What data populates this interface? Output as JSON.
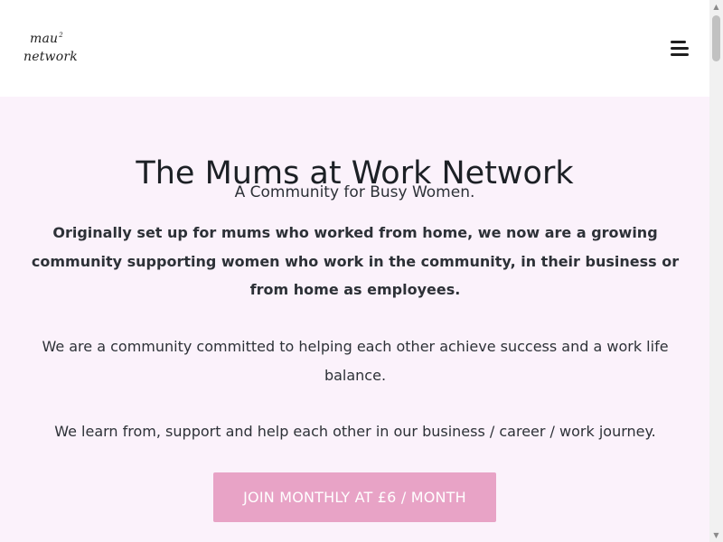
{
  "header": {
    "logo": {
      "line1": "mau",
      "superscript": "2",
      "line2": "network"
    },
    "menu_icon": "hamburger-menu-icon"
  },
  "hero": {
    "title": "The Mums at Work Network",
    "subtitle": "A Community for Busy Women.",
    "intro": "Originally set up for mums who worked from home, we now are a growing community supporting women who work in the community, in their business or from home as employees.",
    "paragraphs": [
      "We are a community committed to helping each other achieve success and a work life balance.",
      "We learn from, support and help each other in our business / career / work journey."
    ],
    "cta_label": "JOIN MONTHLY AT £6 / MONTH"
  },
  "scrollbar": {
    "up_icon": "scroll-up-arrow-icon",
    "down_icon": "scroll-down-arrow-icon"
  },
  "colors": {
    "hero_background": "#fbf2fb",
    "button_background": "#e8a3c6",
    "button_text": "#ffffff",
    "text": "#2d3137"
  }
}
